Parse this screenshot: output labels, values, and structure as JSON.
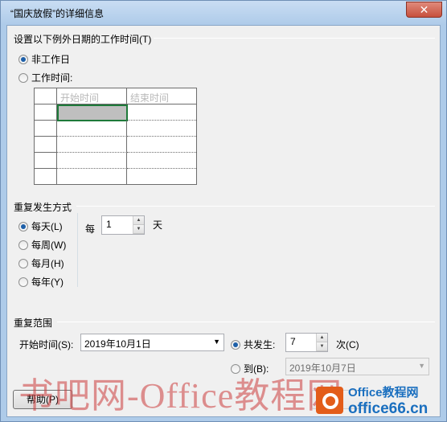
{
  "window": {
    "title": "“国庆放假”的详细信息",
    "close_glyph": "✕"
  },
  "work_time": {
    "group_label": "设置以下例外日期的工作时间(T)",
    "options": [
      {
        "label": "非工作日",
        "checked": true
      },
      {
        "label": "工作时间:",
        "checked": false
      }
    ],
    "columns": [
      "开始时间",
      "结束时间"
    ],
    "rows": 5
  },
  "recurrence": {
    "group_label": "重复发生方式",
    "options": [
      {
        "label": "每天(L)",
        "checked": true
      },
      {
        "label": "每周(W)",
        "checked": false
      },
      {
        "label": "每月(H)",
        "checked": false
      },
      {
        "label": "每年(Y)",
        "checked": false
      }
    ],
    "every_prefix": "每",
    "every_value": "1",
    "every_unit": "天"
  },
  "range": {
    "group_label": "重复范围",
    "start_label": "开始时间(S):",
    "start_value": "2019年10月1日",
    "occurrences_label": "共发生:",
    "occurrences_checked": true,
    "occurrences_value": "7",
    "occurrences_unit": "次(C)",
    "end_label": "到(B):",
    "end_checked": false,
    "end_value": "2019年10月7日"
  },
  "buttons": {
    "help": "帮助(P)"
  },
  "watermark": {
    "text": "书吧网-Office教程网",
    "logo_top": "Office教程网",
    "logo_bottom": "office66.cn"
  }
}
